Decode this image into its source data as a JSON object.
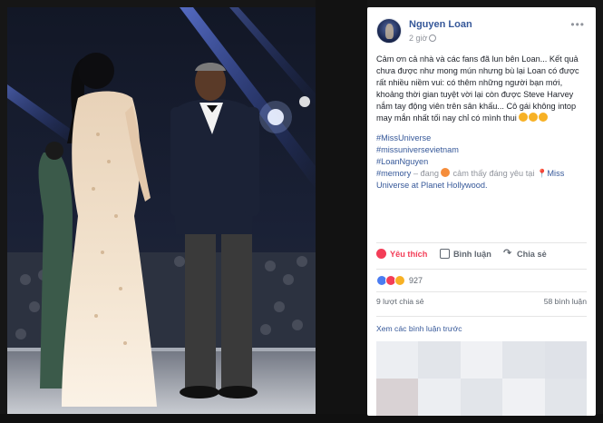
{
  "post": {
    "author": "Nguyen Loan",
    "time": "2 giờ",
    "more_label": "•••",
    "paragraph": "Cảm ơn cả nhà và các fans đã lun bên Loan... Kết quả chưa được như mong mún nhưng bù lại Loan có được rất nhiều niềm vui: có thêm những người bạn mới, khoảng thời gian tuyệt vời lại còn được Steve Harvey nắm tay động viên trên sân khấu... Cô gái không intop may mắn nhất tối nay chỉ có mình thui",
    "hashtags": [
      "#MissUniverse",
      "#missuniversevietnam",
      "#LoanNguyen"
    ],
    "memory_tag": "#memory",
    "activity_prefix": " – đang",
    "activity_text": " cảm thấy đáng yêu tại ",
    "pin_icon": "📍",
    "location": "Miss Universe at Planet Hollywood."
  },
  "actions": {
    "like": "Yêu thích",
    "comment": "Bình luận",
    "share": "Chia sẻ"
  },
  "reactions": {
    "count": "927"
  },
  "stats": {
    "shares": "9 lượt chia sẻ",
    "comments": "58 bình luận"
  },
  "previous_comments": "Xem các bình luận trước",
  "colors": {
    "link": "#365899",
    "like_active": "#f33e58",
    "text": "#1d2129",
    "muted": "#90949c"
  }
}
